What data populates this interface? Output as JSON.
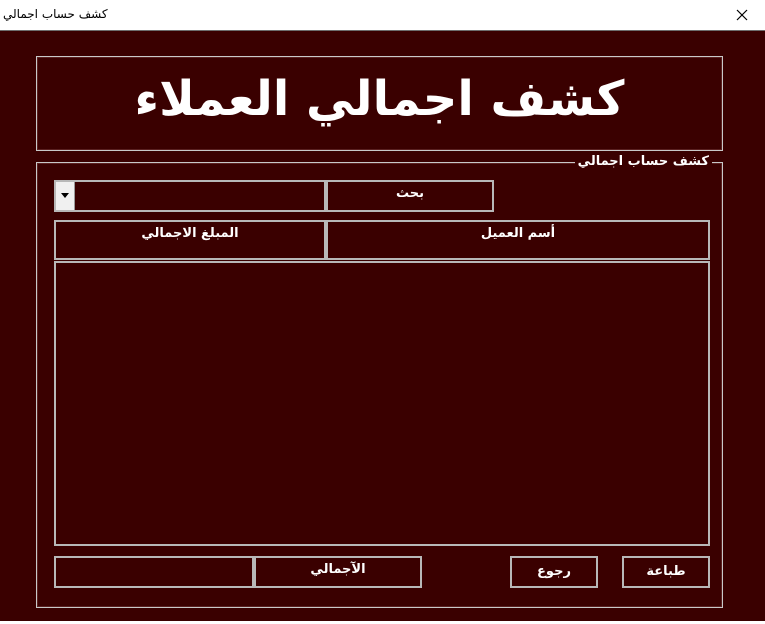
{
  "window": {
    "title": "كشف حساب اجمالي",
    "close_icon": "close-icon"
  },
  "header": {
    "title": "كشف اجمالي العملاء"
  },
  "group": {
    "legend": "كشف حساب اجمالي"
  },
  "search": {
    "combo_value": "",
    "dropdown_icon": "chevron-down-icon",
    "button_label": "بحث"
  },
  "table": {
    "columns": [
      "أسم العميل",
      "المبلغ الاجمالي"
    ],
    "rows": []
  },
  "footer": {
    "total_label": "الآجمالي",
    "total_value": "",
    "back_label": "رجوع",
    "print_label": "طباعة"
  },
  "colors": {
    "background": "#3a0000",
    "text": "#ffffff",
    "border": "#c8c8c8"
  }
}
